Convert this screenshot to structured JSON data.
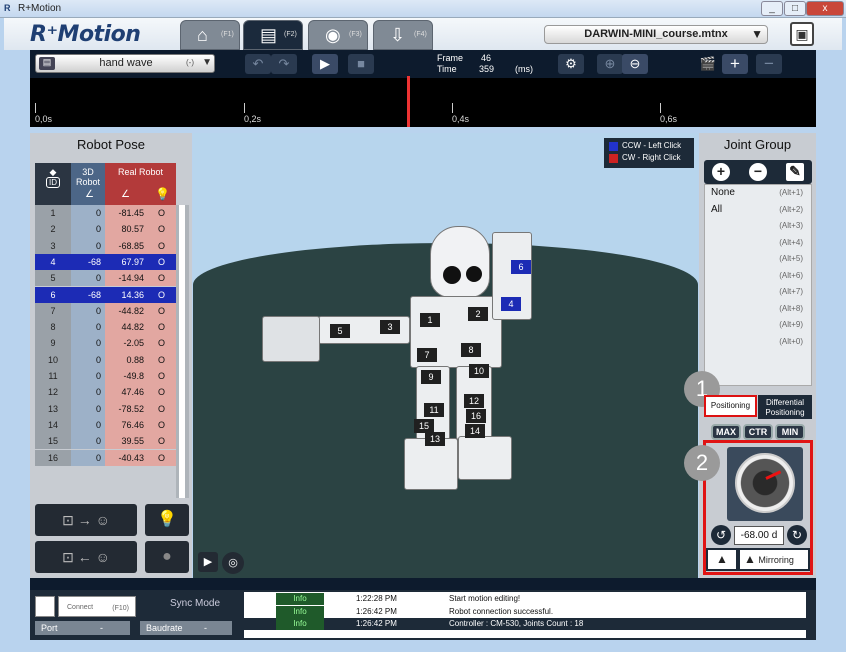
{
  "window": {
    "title": "R+Motion",
    "min": "_",
    "max": "□",
    "close": "x"
  },
  "app": {
    "logo": "R⁺Motion"
  },
  "tabs": [
    {
      "icon": "home-icon",
      "glyph": "⌂",
      "key": "(F1)"
    },
    {
      "icon": "film-icon",
      "glyph": "▤",
      "key": "(F2)"
    },
    {
      "icon": "film-reel-icon",
      "glyph": "◉",
      "key": "(F3)"
    },
    {
      "icon": "download-icon",
      "glyph": "⇩",
      "key": "(F4)"
    }
  ],
  "file": {
    "name": "DARWIN-MINI_course.mtnx"
  },
  "toolbar": {
    "motion_name": "hand wave",
    "motion_num": "(-)",
    "frame_label": "Frame",
    "frame_value": "46",
    "time_label": "Time",
    "time_value": "359",
    "time_unit": "(ms)"
  },
  "timeline": {
    "ticks": [
      "0,0s",
      "0,2s",
      "0,4s",
      "0,6s"
    ]
  },
  "robot_pose": {
    "title": "Robot Pose",
    "col_id": "ID",
    "col_3d": "3D Robot",
    "col_real": "Real Robot",
    "rows": [
      {
        "id": "1",
        "d3": "0",
        "real": "-81.45",
        "led": "O"
      },
      {
        "id": "2",
        "d3": "0",
        "real": "80.57",
        "led": "O"
      },
      {
        "id": "3",
        "d3": "0",
        "real": "-68.85",
        "led": "O"
      },
      {
        "id": "4",
        "d3": "-68",
        "real": "67.97",
        "led": "O"
      },
      {
        "id": "5",
        "d3": "0",
        "real": "-14.94",
        "led": "O"
      },
      {
        "id": "6",
        "d3": "-68",
        "real": "14.36",
        "led": "O"
      },
      {
        "id": "7",
        "d3": "0",
        "real": "-44.82",
        "led": "O"
      },
      {
        "id": "8",
        "d3": "0",
        "real": "44.82",
        "led": "O"
      },
      {
        "id": "9",
        "d3": "0",
        "real": "-2.05",
        "led": "O"
      },
      {
        "id": "10",
        "d3": "0",
        "real": "0.88",
        "led": "O"
      },
      {
        "id": "11",
        "d3": "0",
        "real": "-49.8",
        "led": "O"
      },
      {
        "id": "12",
        "d3": "0",
        "real": "47.46",
        "led": "O"
      },
      {
        "id": "13",
        "d3": "0",
        "real": "-78.52",
        "led": "O"
      },
      {
        "id": "14",
        "d3": "0",
        "real": "76.46",
        "led": "O"
      },
      {
        "id": "15",
        "d3": "0",
        "real": "39.55",
        "led": "O"
      },
      {
        "id": "16",
        "d3": "0",
        "real": "-40.43",
        "led": "O"
      }
    ],
    "selected": [
      "4",
      "6"
    ]
  },
  "viewport": {
    "legend_ccw": "CCW - Left Click",
    "legend_cw": "CW   - Right Click",
    "ccw_color": "#2233cc",
    "cw_color": "#cc2222",
    "joint_labels": [
      "1",
      "2",
      "3",
      "4",
      "5",
      "6",
      "7",
      "8",
      "9",
      "10",
      "11",
      "12",
      "13",
      "14",
      "15",
      "16"
    ]
  },
  "joint_group": {
    "title": "Joint Group",
    "items": [
      {
        "name": "None",
        "key": "(Alt+1)"
      },
      {
        "name": "All",
        "key": "(Alt+2)"
      },
      {
        "name": "",
        "key": "(Alt+3)"
      },
      {
        "name": "",
        "key": "(Alt+4)"
      },
      {
        "name": "",
        "key": "(Alt+5)"
      },
      {
        "name": "",
        "key": "(Alt+6)"
      },
      {
        "name": "",
        "key": "(Alt+7)"
      },
      {
        "name": "",
        "key": "(Alt+8)"
      },
      {
        "name": "",
        "key": "(Alt+9)"
      },
      {
        "name": "",
        "key": "(Alt+0)"
      }
    ]
  },
  "positioning": {
    "tab_positioning": "Positioning",
    "tab_differential": "Differential Positioning",
    "max": "MAX",
    "ctr": "CTR",
    "min": "MIN",
    "value": "-68.00 d",
    "mirroring": "Mirroring",
    "badge1": "1",
    "badge2": "2",
    "highlight_color": "#e01414"
  },
  "bottom": {
    "connect": "Connect",
    "connect_key": "(F10)",
    "sync_mode": "Sync Mode",
    "port": "Port",
    "port_val": "-",
    "baudrate": "Baudrate",
    "baud_val": "-"
  },
  "log": [
    {
      "level": "Info",
      "time": "1:22:28 PM",
      "msg": "Start motion editing!"
    },
    {
      "level": "Info",
      "time": "1:26:42 PM",
      "msg": "Robot connection successful."
    },
    {
      "level": "Info",
      "time": "1:26:42 PM",
      "msg": "Controller : CM-530,  Joints Count : 18"
    }
  ]
}
